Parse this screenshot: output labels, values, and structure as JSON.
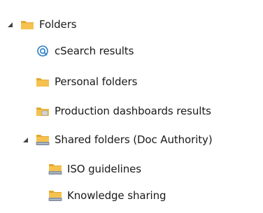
{
  "tree": {
    "root": {
      "label": "Folders",
      "icon": "folder-icon",
      "expanded": true,
      "children": [
        {
          "label": "cSearch results",
          "icon": "search-icon"
        },
        {
          "label": "Personal folders",
          "icon": "folder-icon"
        },
        {
          "label": "Production dashboards results",
          "icon": "dashboard-folder-icon"
        },
        {
          "label": "Shared folders (Doc Authority)",
          "icon": "shared-folder-icon",
          "expanded": true,
          "children": [
            {
              "label": "ISO guidelines",
              "icon": "shared-folder-icon"
            },
            {
              "label": "Knowledge sharing",
              "icon": "shared-folder-icon"
            }
          ]
        }
      ]
    }
  },
  "colors": {
    "folder": "#f5c24f",
    "folder_dark": "#e0a82e",
    "search": "#2a7fc9",
    "shared_tray": "#8a96a6",
    "toggle": "#444444"
  }
}
